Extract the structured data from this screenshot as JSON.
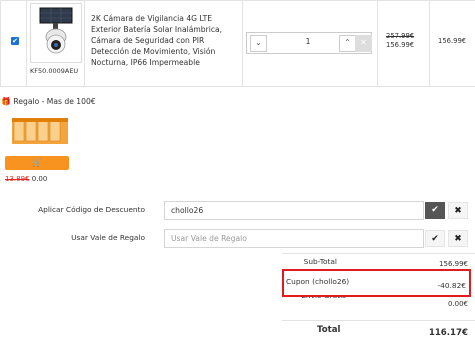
{
  "cart_item": {
    "checked": true,
    "sku": "KF50.0009AEU",
    "name_lines": [
      "2K Cámara de Vigilancia 4G LTE",
      "Exterior Batería Solar Inalámbrica,",
      "Cámara de Seguridad con PIR",
      "Detección de Movimiento, Visión",
      "Nocturna, IP66 Impermeable"
    ],
    "quantity": "1",
    "old_price": "257.99€",
    "price": "156.99€",
    "total": "156.99€"
  },
  "gift": {
    "title": "Regalo - Mas de 100€",
    "old_price": "13.89€",
    "price": "0.00"
  },
  "discount": {
    "label": "Aplicar Código de Descuento",
    "value": "chollo26"
  },
  "voucher": {
    "label": "Usar Vale de Regalo",
    "placeholder": "Usar Vale de Regalo"
  },
  "totals": {
    "subtotal_label": "Sub-Total",
    "subtotal_value": "156.99€",
    "coupon_label": "Cupon (chollo26)",
    "coupon_value": "-40.82€",
    "shipping_label": "Envío Gratis",
    "shipping_value": "0.00€",
    "total_label": "Total",
    "total_value": "116.17€"
  },
  "colors": {
    "accent": "#f7931e",
    "highlight": "#e11b22",
    "checkbox": "#1b73d3"
  }
}
